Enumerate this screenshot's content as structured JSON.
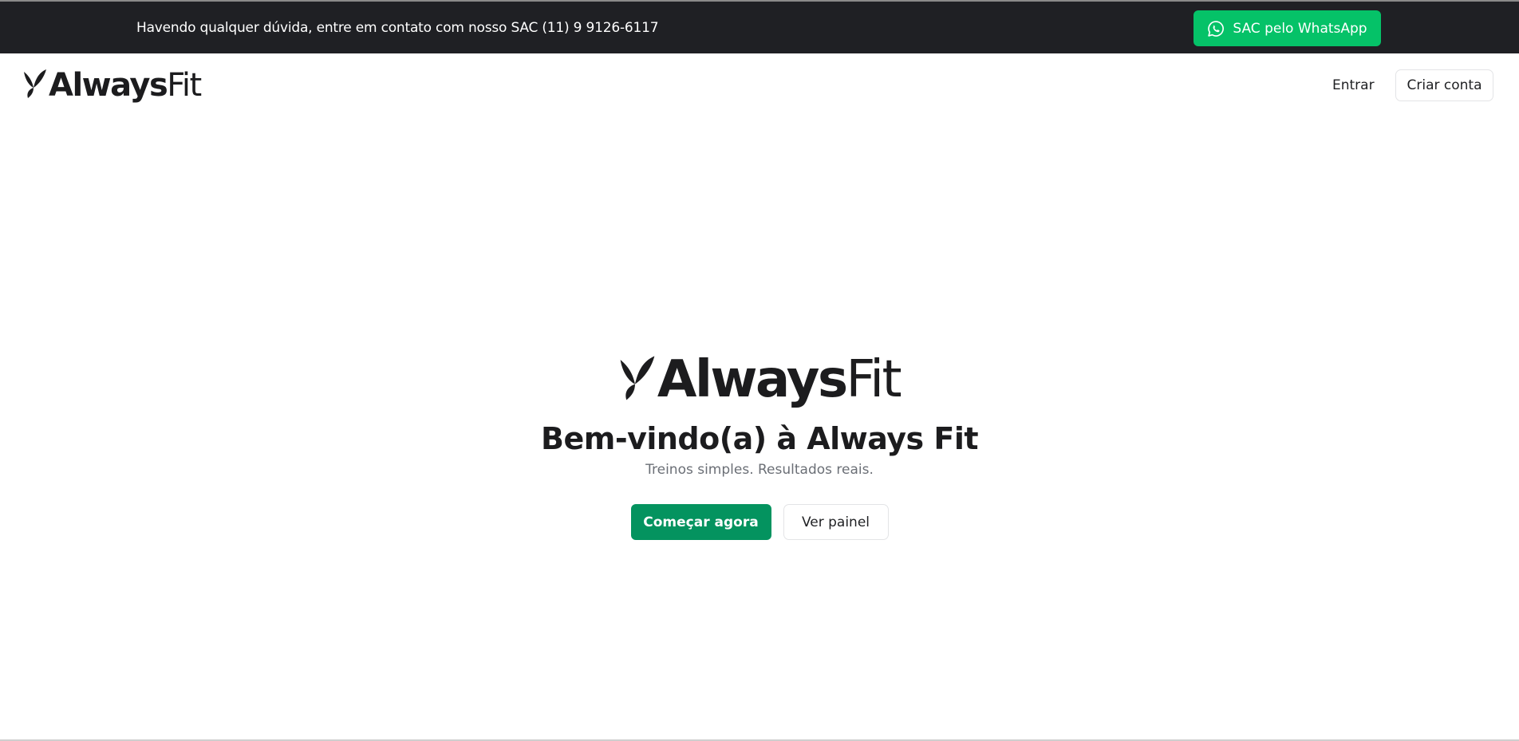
{
  "topbar": {
    "message": "Havendo qualquer dúvida, entre em contato com nosso SAC (11) 9 9126-6117",
    "whatsapp_button": "SAC pelo WhatsApp",
    "whatsapp_icon": "whatsapp-icon"
  },
  "header": {
    "logo": {
      "bold": "Always",
      "light": "Fit",
      "icon": "leaf-logo-icon"
    },
    "login_link": "Entrar",
    "signup_button": "Criar conta"
  },
  "hero": {
    "logo": {
      "bold": "Always",
      "light": "Fit"
    },
    "title": "Bem-vindo(a) à Always Fit",
    "subtitle": "Treinos simples. Resultados reais.",
    "primary_button": "Começar agora",
    "secondary_button": "Ver painel"
  },
  "colors": {
    "topbar_bg": "#1f2024",
    "whatsapp_green": "#05c268",
    "primary_green": "#04935f",
    "text_dark": "#1c1c1e",
    "text_muted": "#6b6f76"
  }
}
